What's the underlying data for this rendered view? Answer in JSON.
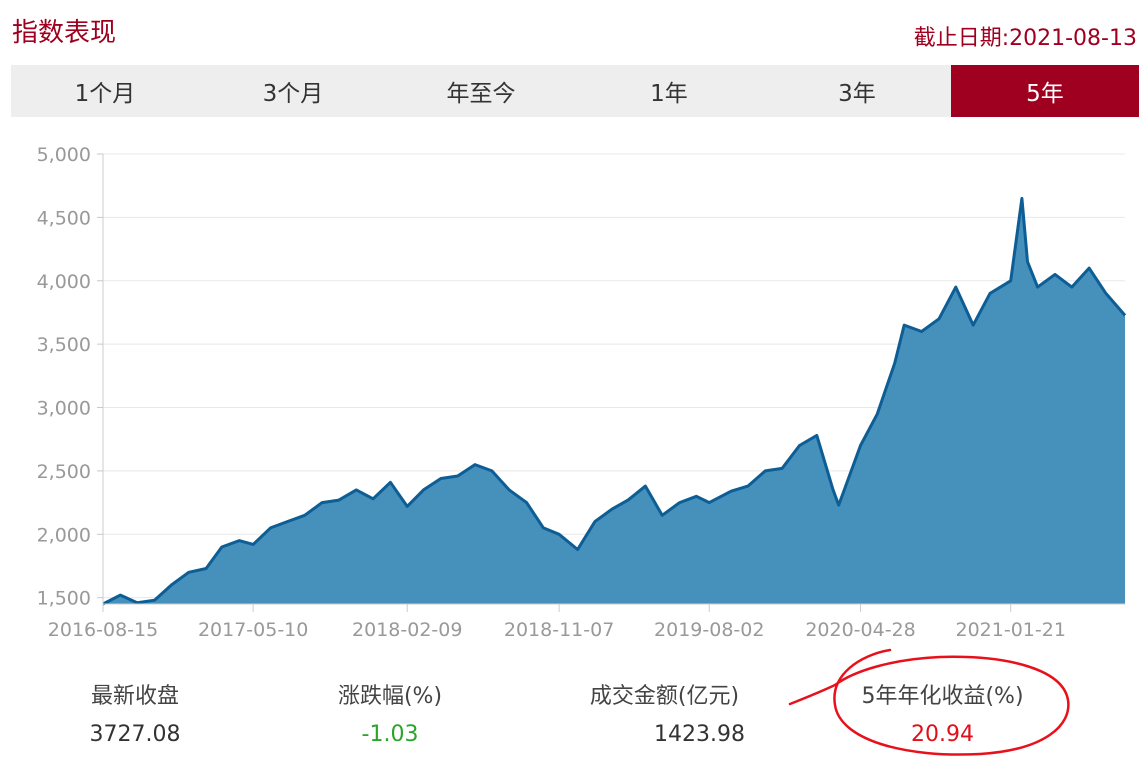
{
  "header": {
    "title": "指数表现",
    "date_text": "截止日期:2021-08-13"
  },
  "tabs": [
    {
      "label": "1个月",
      "active": false
    },
    {
      "label": "3个月",
      "active": false
    },
    {
      "label": "年至今",
      "active": false
    },
    {
      "label": "1年",
      "active": false
    },
    {
      "label": "3年",
      "active": false
    },
    {
      "label": "5年",
      "active": true
    }
  ],
  "colors": {
    "accent": "#a00020",
    "area_fill": "#3c8ab8",
    "line": "#0c5e95",
    "annotation": "#e8101a"
  },
  "chart_data": {
    "type": "area",
    "ylim": [
      1450,
      5000
    ],
    "yticks": [
      1500,
      2000,
      2500,
      3000,
      3500,
      4000,
      4500,
      5000
    ],
    "ytick_labels": [
      "1,500",
      "2,000",
      "2,500",
      "3,000",
      "3,500",
      "4,000",
      "4,500",
      "5,000"
    ],
    "xlim": [
      "2016-08-15",
      "2021-08-13"
    ],
    "xticks": [
      "2016-08-15",
      "2017-05-10",
      "2018-02-09",
      "2018-11-07",
      "2019-08-02",
      "2020-04-28",
      "2021-01-21"
    ],
    "grid": true,
    "series": [
      {
        "x": [
          "2016-08-15",
          "2016-09-15",
          "2016-10-15",
          "2016-11-15",
          "2016-12-15",
          "2017-01-15",
          "2017-02-15",
          "2017-03-15",
          "2017-04-15",
          "2017-05-10",
          "2017-06-10",
          "2017-07-10",
          "2017-08-10",
          "2017-09-10",
          "2017-10-10",
          "2017-11-10",
          "2017-12-10",
          "2018-01-10",
          "2018-02-09",
          "2018-03-10",
          "2018-04-10",
          "2018-05-10",
          "2018-06-10",
          "2018-07-10",
          "2018-08-10",
          "2018-09-10",
          "2018-10-10",
          "2018-11-07",
          "2018-12-10",
          "2019-01-10",
          "2019-02-10",
          "2019-03-10",
          "2019-04-10",
          "2019-05-10",
          "2019-06-10",
          "2019-07-10",
          "2019-08-02",
          "2019-09-10",
          "2019-10-10",
          "2019-11-10",
          "2019-12-10",
          "2020-01-10",
          "2020-02-10",
          "2020-03-10",
          "2020-03-20",
          "2020-04-28",
          "2020-05-28",
          "2020-06-28",
          "2020-07-15",
          "2020-08-15",
          "2020-09-15",
          "2020-10-15",
          "2020-11-15",
          "2020-12-15",
          "2021-01-21",
          "2021-02-10",
          "2021-02-20",
          "2021-03-10",
          "2021-04-10",
          "2021-05-10",
          "2021-06-10",
          "2021-07-10",
          "2021-08-13"
        ],
        "y": [
          1450,
          1520,
          1460,
          1480,
          1600,
          1700,
          1730,
          1900,
          1950,
          1920,
          2050,
          2100,
          2150,
          2250,
          2270,
          2350,
          2280,
          2410,
          2220,
          2350,
          2440,
          2460,
          2550,
          2500,
          2350,
          2250,
          2050,
          2000,
          1880,
          2100,
          2200,
          2270,
          2380,
          2150,
          2250,
          2300,
          2250,
          2340,
          2380,
          2500,
          2520,
          2700,
          2780,
          2350,
          2230,
          2700,
          2950,
          3350,
          3650,
          3600,
          3700,
          3950,
          3650,
          3900,
          4000,
          4650,
          4150,
          3950,
          4050,
          3950,
          4100,
          3900,
          3727
        ]
      }
    ]
  },
  "stats": [
    {
      "label": "最新收盘",
      "value": "3727.08",
      "tone": "neutral"
    },
    {
      "label": "涨跌幅(%)",
      "value": "-1.03",
      "tone": "down"
    },
    {
      "label": "成交金额(亿元)",
      "value": "1423.98",
      "tone": "neutral"
    },
    {
      "label": "5年年化收益(%)",
      "value": "20.94",
      "tone": "up",
      "highlighted": true
    }
  ]
}
